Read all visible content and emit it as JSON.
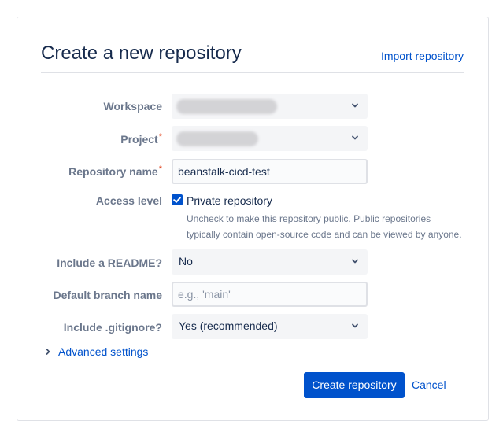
{
  "header": {
    "title": "Create a new repository",
    "import_link": "Import repository"
  },
  "form": {
    "workspace": {
      "label": "Workspace",
      "required": false,
      "value_obscured": true
    },
    "project": {
      "label": "Project",
      "required": true,
      "value_obscured": true
    },
    "repository_name": {
      "label": "Repository name",
      "required": true,
      "value": "beanstalk-cicd-test"
    },
    "access_level": {
      "label": "Access level",
      "checkbox_label": "Private repository",
      "checked": true,
      "helper_line1": "Uncheck to make this repository public. Public repositories",
      "helper_line2": "typically contain open-source code and can be viewed by anyone."
    },
    "readme": {
      "label": "Include a README?",
      "value": "No"
    },
    "default_branch": {
      "label": "Default branch name",
      "value": "",
      "placeholder": "e.g., 'main'"
    },
    "gitignore": {
      "label": "Include .gitignore?",
      "value": "Yes (recommended)"
    },
    "required_marker": "*"
  },
  "advanced_settings": {
    "label": "Advanced settings",
    "icon": "chevron-right-icon"
  },
  "actions": {
    "create_label": "Create repository",
    "cancel_label": "Cancel"
  },
  "colors": {
    "primary": "#0052cc",
    "text": "#172b4d",
    "label": "#6b778c",
    "required": "#de350b",
    "field_bg": "#f4f5f7",
    "border": "#dfe1e6"
  }
}
